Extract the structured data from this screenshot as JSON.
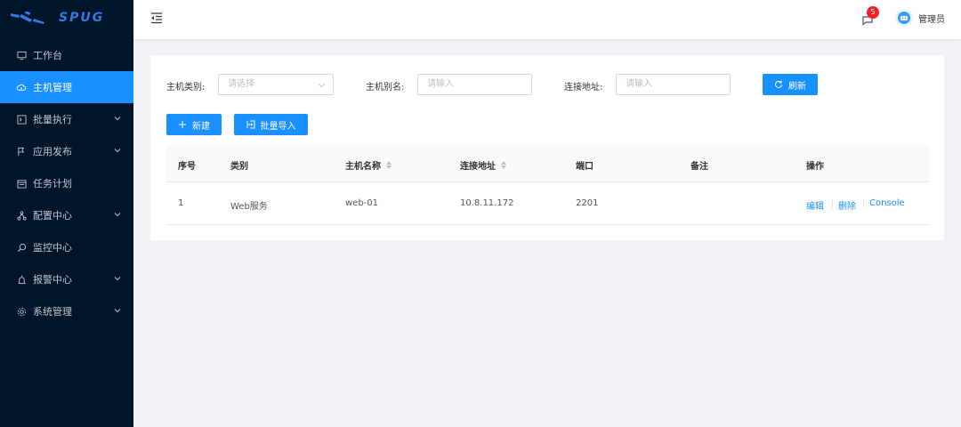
{
  "brand": {
    "logo_text": "SPUG",
    "accent": "#1890ff",
    "sidebar_bg": "#001529"
  },
  "sidebar": {
    "items": [
      {
        "label": "工作台",
        "icon": "monitor-icon",
        "active": false,
        "has_children": false
      },
      {
        "label": "主机管理",
        "icon": "cloud-server-icon",
        "active": true,
        "has_children": false
      },
      {
        "label": "批量执行",
        "icon": "code-icon",
        "active": false,
        "has_children": true
      },
      {
        "label": "应用发布",
        "icon": "flag-icon",
        "active": false,
        "has_children": true
      },
      {
        "label": "任务计划",
        "icon": "schedule-icon",
        "active": false,
        "has_children": false
      },
      {
        "label": "配置中心",
        "icon": "deployment-unit-icon",
        "active": false,
        "has_children": true
      },
      {
        "label": "监控中心",
        "icon": "search-icon",
        "active": false,
        "has_children": false
      },
      {
        "label": "报警中心",
        "icon": "alert-icon",
        "active": false,
        "has_children": true
      },
      {
        "label": "系统管理",
        "icon": "setting-icon",
        "active": false,
        "has_children": true
      }
    ]
  },
  "header": {
    "notification_count": "5",
    "user_name": "管理员"
  },
  "filters": {
    "category_label": "主机类别:",
    "category_placeholder": "请选择",
    "alias_label": "主机别名:",
    "alias_placeholder": "请输入",
    "address_label": "连接地址:",
    "address_placeholder": "请输入",
    "refresh_label": "刷新"
  },
  "toolbar": {
    "new_label": "新建",
    "import_label": "批量导入"
  },
  "table": {
    "columns": [
      "序号",
      "类别",
      "主机名称",
      "连接地址",
      "端口",
      "备注",
      "操作"
    ],
    "rows": [
      {
        "index": "1",
        "category": "Web服务",
        "name": "web-01",
        "address": "10.8.11.172",
        "port": "2201",
        "note": "",
        "actions": [
          "编辑",
          "删除",
          "Console"
        ]
      }
    ]
  }
}
